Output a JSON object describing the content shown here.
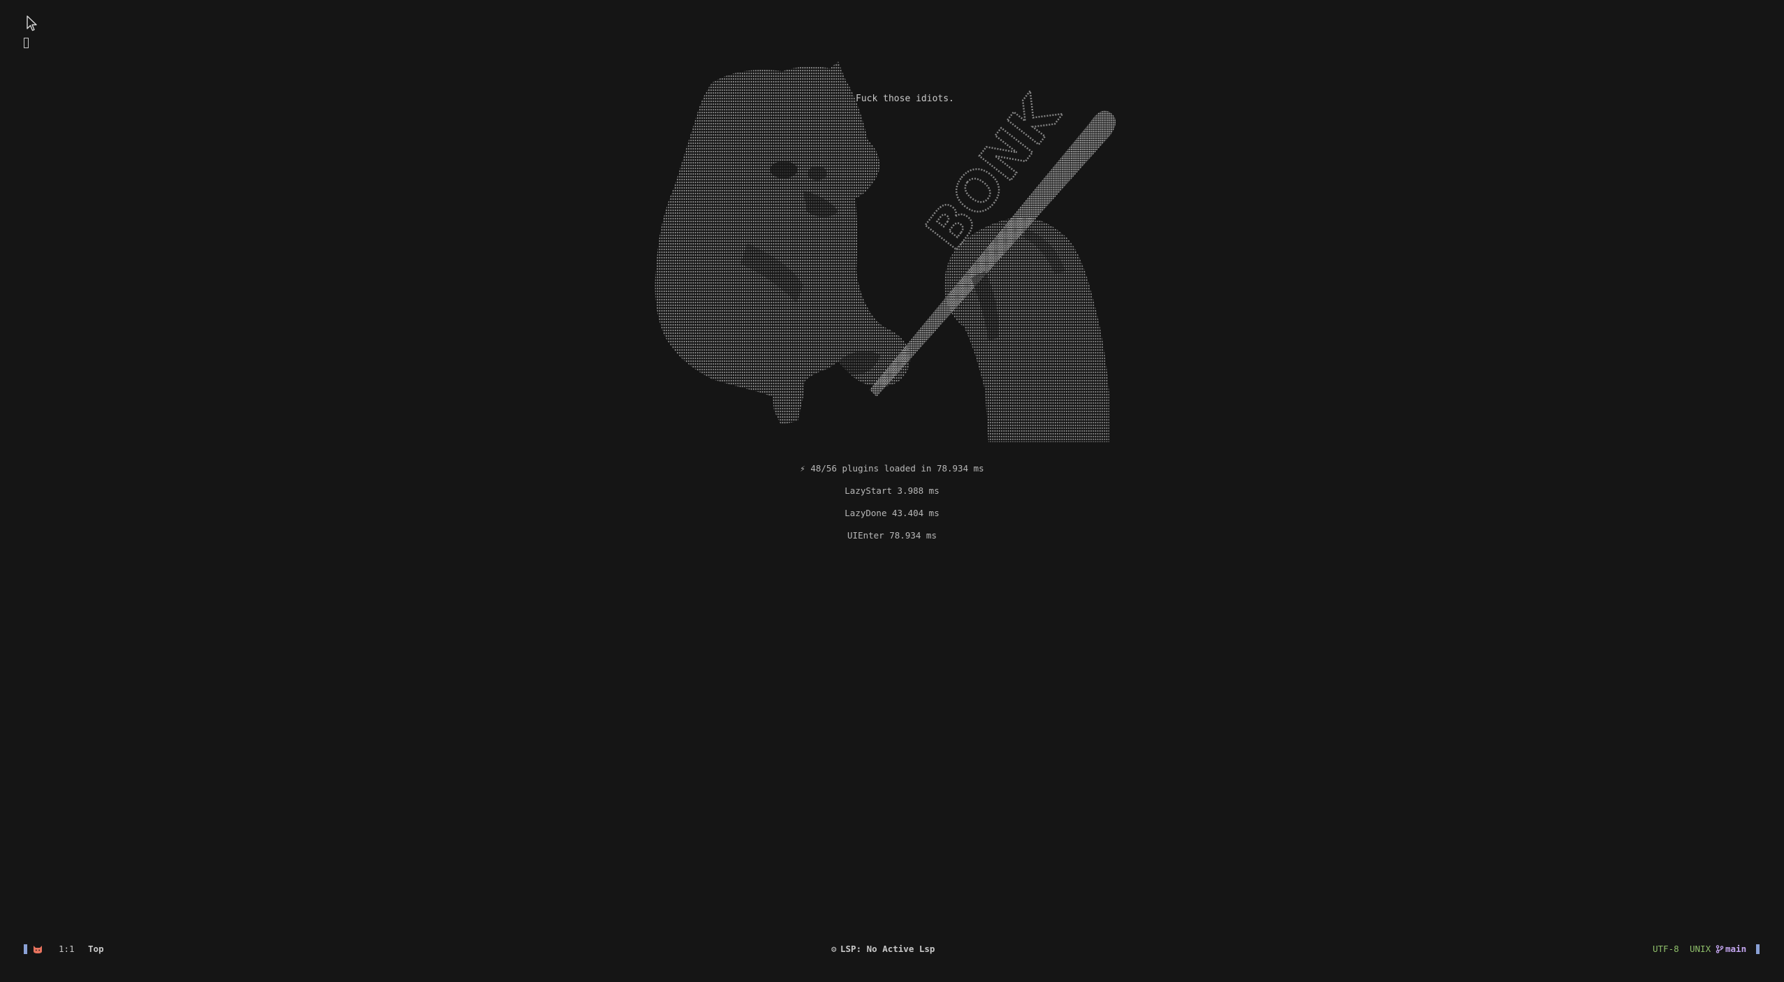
{
  "dashboard": {
    "header_quote": "Fuck those idiots.",
    "art_label": "BONK",
    "stats": {
      "plugins_icon": "lightning-bolt-icon",
      "plugins_line": "48/56 plugins loaded in 78.934 ms",
      "lazy_start": "LazyStart 3.988 ms",
      "lazy_done": "LazyDone 43.404 ms",
      "ui_enter": "UIEnter 78.934 ms"
    }
  },
  "statusline": {
    "mode_icon": "cat-face-icon",
    "position": "1:1",
    "scroll": "Top",
    "lsp_icon": "gears-icon",
    "lsp_status": "LSP: No Active Lsp",
    "encoding": "UTF-8",
    "fileformat": "UNIX",
    "branch_icon": "git-branch-icon",
    "branch": "main"
  },
  "colors": {
    "background": "#151515",
    "text": "#b4b4b4",
    "accent_bar": "#8aa1d6",
    "encoding_green": "#8fbf6a",
    "branch_purple": "#c3a5ee",
    "mode_icon_color": "#e8735e"
  }
}
